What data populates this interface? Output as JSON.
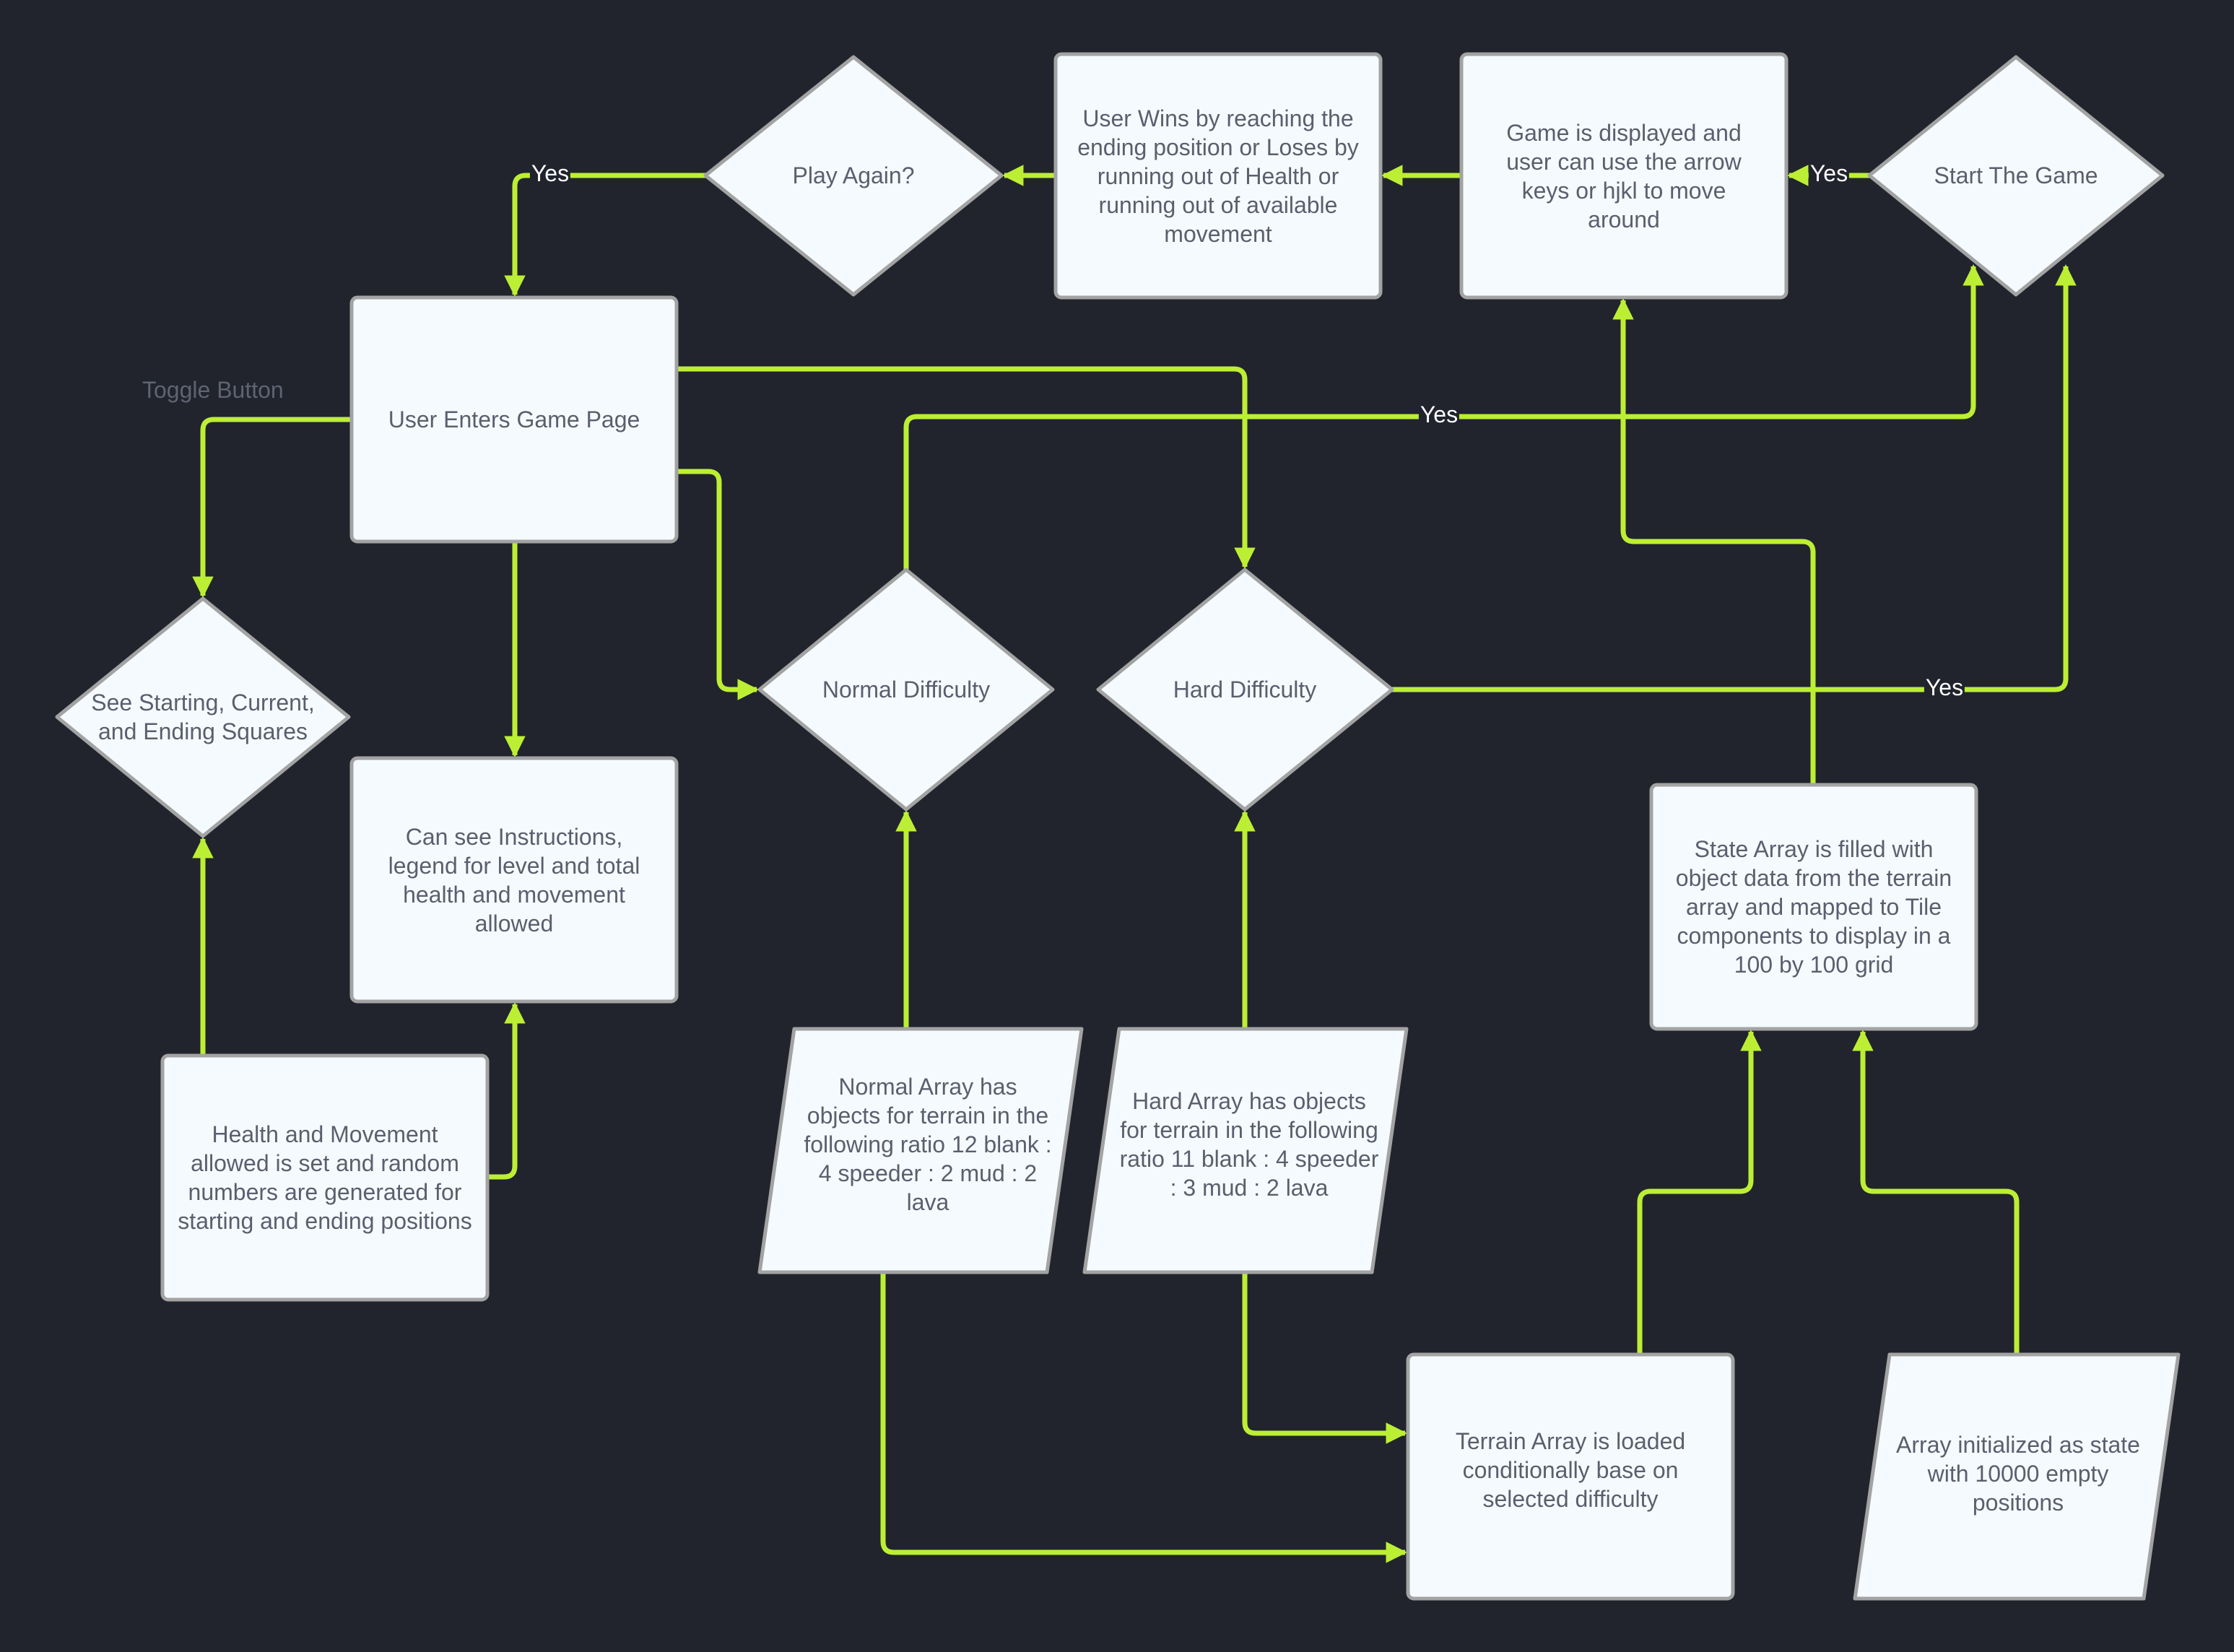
{
  "colors": {
    "background": "#21242d",
    "connector": "#bcef34",
    "node_fill": "#f5faff",
    "node_border": "#a3a3a3",
    "node_text": "#5a5f6e",
    "edge_label_text": "#ffffff"
  },
  "nodes": {
    "play_again": {
      "type": "decision",
      "text": "Play Again?"
    },
    "user_wins": {
      "type": "process",
      "text": "User Wins by reaching the ending position or Loses by running out of Health or running out of available movement"
    },
    "game_displayed": {
      "type": "process",
      "text": "Game is displayed and user can use the arrow keys or hjkl to move around"
    },
    "start_game": {
      "type": "decision",
      "text": "Start The Game"
    },
    "user_enters": {
      "type": "process",
      "text": "User Enters Game Page"
    },
    "see_squares": {
      "type": "decision",
      "text": "See Starting, Current, and Ending Squares"
    },
    "instructions": {
      "type": "process",
      "text": "Can see Instructions, legend for level and total health and movement allowed"
    },
    "normal_difficulty": {
      "type": "decision",
      "text": "Normal Difficulty"
    },
    "hard_difficulty": {
      "type": "decision",
      "text": "Hard Difficulty"
    },
    "state_array": {
      "type": "process",
      "text": "State Array is filled with object data from the terrain array and mapped to Tile components to display in a 100 by 100 grid"
    },
    "health_movement": {
      "type": "process",
      "text": "Health and Movement allowed is set and random numbers are generated for starting and ending positions"
    },
    "normal_array": {
      "type": "data",
      "text": "Normal Array has objects for terrain in the following ratio 12 blank : 4 speeder : 2 mud : 2 lava"
    },
    "hard_array": {
      "type": "data",
      "text": "Hard Array has objects for terrain in the following ratio 11 blank : 4 speeder : 3 mud : 2 lava"
    },
    "terrain_array": {
      "type": "process",
      "text": "Terrain Array is loaded conditionally base on selected difficulty"
    },
    "array_initialized": {
      "type": "data",
      "text": "Array initialized as state with 10000 empty positions"
    }
  },
  "annotations": {
    "toggle_button": "Toggle Button"
  },
  "edges": [
    {
      "from": "play_again",
      "to": "user_enters",
      "label": "Yes"
    },
    {
      "from": "user_wins",
      "to": "play_again",
      "label": ""
    },
    {
      "from": "game_displayed",
      "to": "user_wins",
      "label": ""
    },
    {
      "from": "start_game",
      "to": "game_displayed",
      "label": "Yes"
    },
    {
      "from": "user_enters",
      "to": "see_squares",
      "label": ""
    },
    {
      "from": "user_enters",
      "to": "instructions",
      "label": ""
    },
    {
      "from": "user_enters",
      "to": "hard_difficulty",
      "label": ""
    },
    {
      "from": "user_enters",
      "to": "normal_difficulty",
      "label": ""
    },
    {
      "from": "normal_difficulty",
      "to": "start_game",
      "label": "Yes"
    },
    {
      "from": "hard_difficulty",
      "to": "start_game",
      "label": "Yes"
    },
    {
      "from": "state_array",
      "to": "game_displayed",
      "label": ""
    },
    {
      "from": "health_movement",
      "to": "instructions",
      "label": ""
    },
    {
      "from": "health_movement",
      "to": "see_squares",
      "label": ""
    },
    {
      "from": "normal_array",
      "to": "normal_difficulty",
      "label": ""
    },
    {
      "from": "hard_array",
      "to": "hard_difficulty",
      "label": ""
    },
    {
      "from": "normal_array",
      "to": "terrain_array",
      "label": ""
    },
    {
      "from": "hard_array",
      "to": "terrain_array",
      "label": ""
    },
    {
      "from": "terrain_array",
      "to": "state_array",
      "label": ""
    },
    {
      "from": "array_initialized",
      "to": "state_array",
      "label": ""
    }
  ]
}
